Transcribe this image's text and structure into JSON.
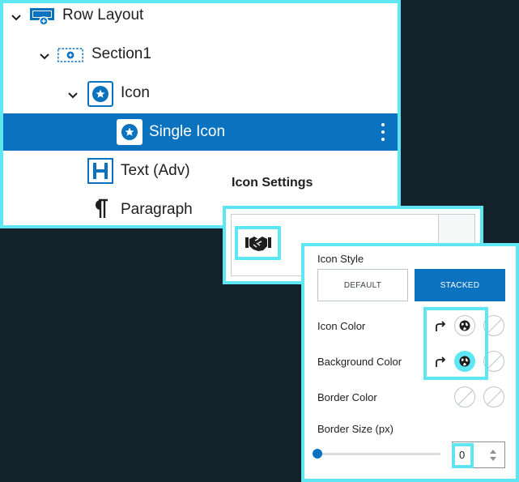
{
  "tree": {
    "items": [
      {
        "label": "Row Layout",
        "icon": "row-layout-icon"
      },
      {
        "label": "Section1",
        "icon": "section-icon"
      },
      {
        "label": "Icon",
        "icon": "icon-block-icon"
      },
      {
        "label": "Single Icon",
        "icon": "single-icon-block-icon",
        "selected": true
      },
      {
        "label": "Text (Adv)",
        "icon": "heading-icon"
      },
      {
        "label": "Paragraph",
        "icon": "paragraph-icon"
      }
    ]
  },
  "icon_settings": {
    "heading": "Icon Settings",
    "selected_icon": "handshake-icon"
  },
  "style": {
    "icon_style_label": "Icon Style",
    "options": [
      "DEFAULT",
      "STACKED"
    ],
    "selected": "STACKED",
    "icon_color_label": "Icon Color",
    "background_color_label": "Background Color",
    "border_color_label": "Border Color",
    "border_size_label": "Border Size (px)",
    "border_size_value": "0"
  },
  "colors": {
    "highlight": "#5ee7f2",
    "accent": "#0b72bf",
    "backdrop": "#13212a"
  }
}
